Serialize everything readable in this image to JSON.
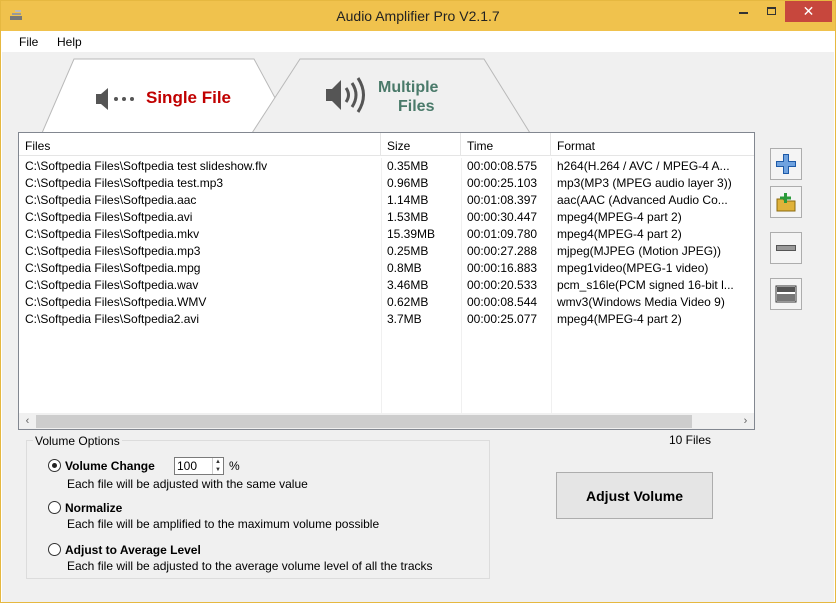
{
  "window": {
    "title": "Audio Amplifier Pro V2.1.7"
  },
  "menu": {
    "file": "File",
    "help": "Help"
  },
  "tabs": {
    "single": {
      "label": "Single File"
    },
    "multiple": {
      "label_line1": "Multiple",
      "label_line2": "Files"
    }
  },
  "list": {
    "columns": [
      "Files",
      "Size",
      "Time",
      "Format"
    ],
    "rows": [
      [
        "C:\\Softpedia Files\\Softpedia test slideshow.flv",
        "0.35MB",
        "00:00:08.575",
        "h264(H.264 / AVC / MPEG-4 A..."
      ],
      [
        "C:\\Softpedia Files\\Softpedia test.mp3",
        "0.96MB",
        "00:00:25.103",
        "mp3(MP3 (MPEG audio layer 3))"
      ],
      [
        "C:\\Softpedia Files\\Softpedia.aac",
        "1.14MB",
        "00:01:08.397",
        "aac(AAC (Advanced Audio Co..."
      ],
      [
        "C:\\Softpedia Files\\Softpedia.avi",
        "1.53MB",
        "00:00:30.447",
        "mpeg4(MPEG-4 part 2)"
      ],
      [
        "C:\\Softpedia Files\\Softpedia.mkv",
        "15.39MB",
        "00:01:09.780",
        "mpeg4(MPEG-4 part 2)"
      ],
      [
        "C:\\Softpedia Files\\Softpedia.mp3",
        "0.25MB",
        "00:00:27.288",
        "mjpeg(MJPEG (Motion JPEG))"
      ],
      [
        "C:\\Softpedia Files\\Softpedia.mpg",
        "0.8MB",
        "00:00:16.883",
        "mpeg1video(MPEG-1 video)"
      ],
      [
        "C:\\Softpedia Files\\Softpedia.wav",
        "3.46MB",
        "00:00:20.533",
        "pcm_s16le(PCM signed 16-bit l..."
      ],
      [
        "C:\\Softpedia Files\\Softpedia.WMV",
        "0.62MB",
        "00:00:08.544",
        "wmv3(Windows Media Video 9)"
      ],
      [
        "C:\\Softpedia Files\\Softpedia2.avi",
        "3.7MB",
        "00:00:25.077",
        "mpeg4(MPEG-4 part 2)"
      ]
    ],
    "count": "10 Files"
  },
  "volume_options": {
    "legend": "Volume Options",
    "volume_change": {
      "title": "Volume Change",
      "desc": "Each file will be adjusted with the same value",
      "value": "100",
      "unit": "%"
    },
    "normalize": {
      "title": "Normalize",
      "desc": "Each file will be amplified to the maximum volume possible"
    },
    "average": {
      "title": "Adjust to Average Level",
      "desc": "Each file will be adjusted to the average volume level of all the tracks"
    }
  },
  "adjust_button": "Adjust Volume",
  "icons": {
    "add": "plus-icon",
    "add_folder": "add-folder-icon",
    "remove": "minus-icon",
    "clear": "clear-list-icon"
  },
  "colors": {
    "titlebar": "#f0c24d",
    "close": "#c7473d",
    "single_label": "#c00000",
    "multiple_label": "#4a7a6a",
    "add_icon": "#1e5aa8"
  }
}
